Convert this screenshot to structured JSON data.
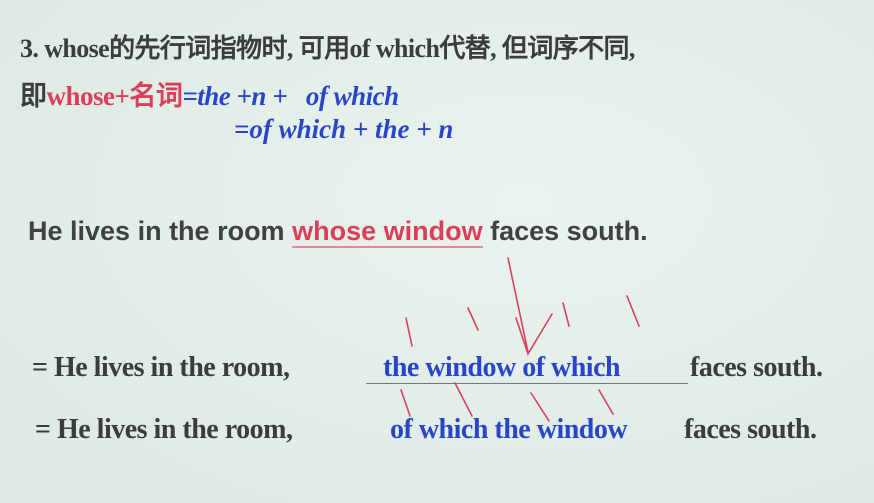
{
  "rule": {
    "line1": "3. whose的先行词指物时, 可用of which代替, 但词序不同,",
    "line2_prefix": "即",
    "line2_red": "whose+名词",
    "line2_blue": "=the +n +   of which",
    "line3_blue": "=of which + the + n"
  },
  "example": {
    "before": "He lives in the room ",
    "highlight": "whose window",
    "after": " faces south."
  },
  "rewrite1": {
    "prefix": "= He lives in the room,",
    "blue": "the window of which",
    "suffix": "faces south."
  },
  "rewrite2": {
    "prefix": "= He lives in the room,",
    "blue": "of which the window",
    "suffix": "faces south."
  },
  "colors": {
    "red": "#d8405a",
    "blue": "#2a46c8",
    "text": "#3a3d3c",
    "background": "#e3ede7"
  }
}
